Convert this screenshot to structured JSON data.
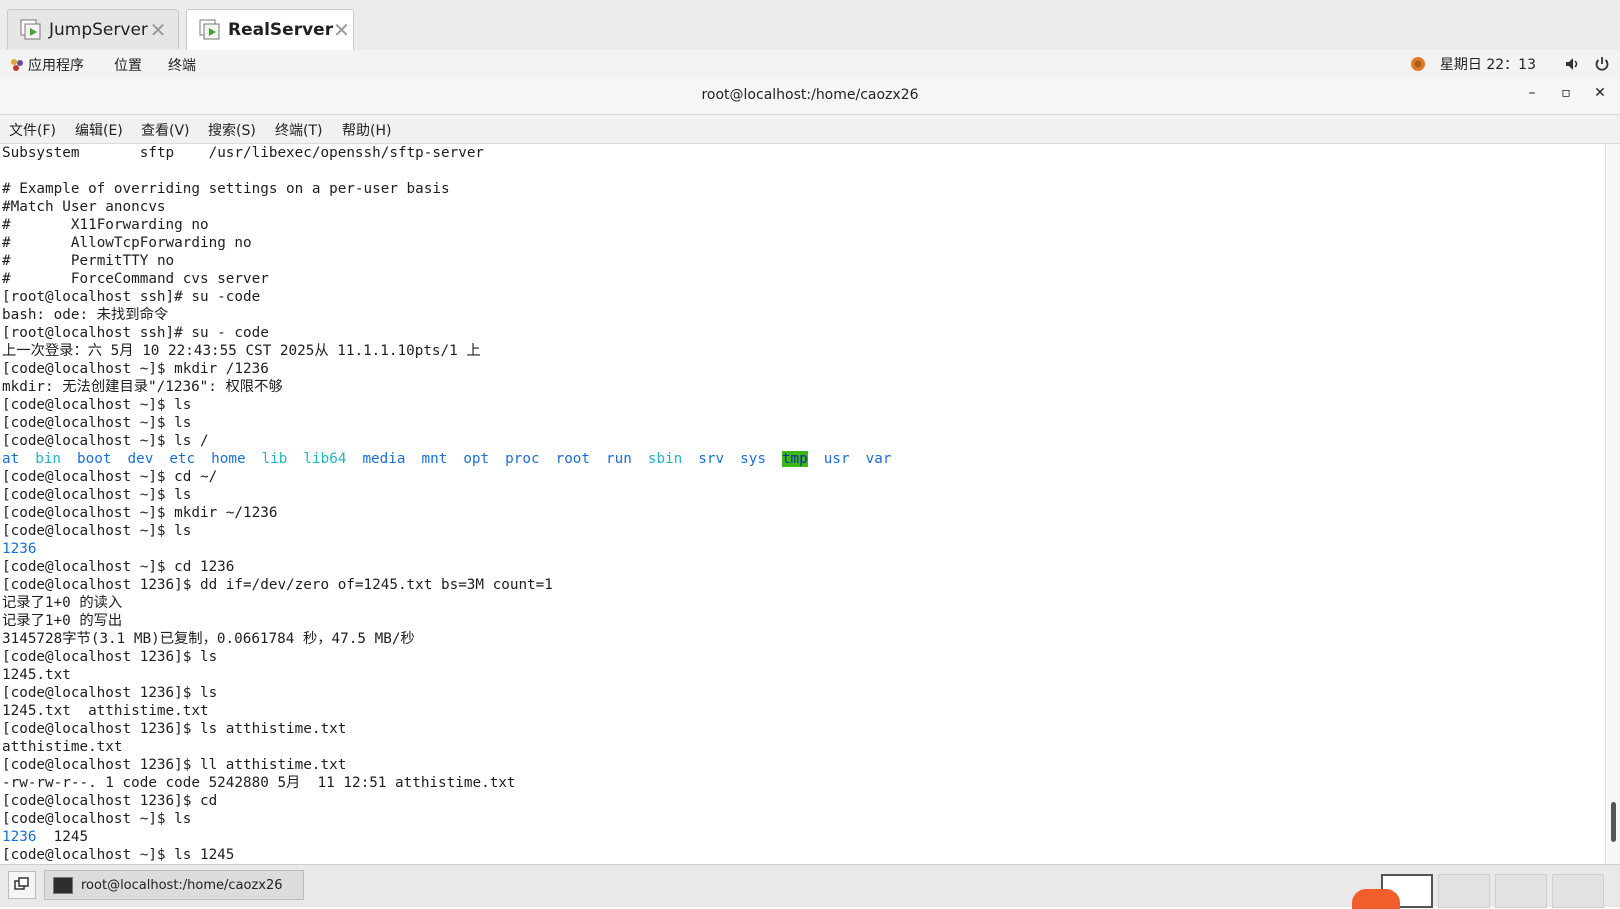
{
  "tabs": [
    {
      "label": "JumpServer",
      "active": false
    },
    {
      "label": "RealServer",
      "active": true
    }
  ],
  "topbar": {
    "menus": [
      "应用程序",
      "位置",
      "终端"
    ],
    "clock": "星期日 22：13"
  },
  "window": {
    "title": "root@localhost:/home/caozx26",
    "minimize": "–",
    "maximize": "▫",
    "close": "✕"
  },
  "menubar": [
    "文件(F)",
    "编辑(E)",
    "查看(V)",
    "搜索(S)",
    "终端(T)",
    "帮助(H)"
  ],
  "terminal": {
    "lines": [
      "Subsystem\tsftp\t/usr/libexec/openssh/sftp-server",
      "",
      "# Example of overriding settings on a per-user basis",
      "#Match User anoncvs",
      "#\tX11Forwarding no",
      "#\tAllowTcpForwarding no",
      "#\tPermitTTY no",
      "#\tForceCommand cvs server",
      "[root@localhost ssh]# su -code",
      "bash: ode: 未找到命令",
      "[root@localhost ssh]# su - code",
      "上一次登录：六 5月 10 22:43:55 CST 2025从 11.1.1.10pts/1 上",
      "[code@localhost ~]$ mkdir /1236",
      "mkdir: 无法创建目录\"/1236\": 权限不够",
      "[code@localhost ~]$ ls",
      "[code@localhost ~]$ ls",
      "[code@localhost ~]$ ls /"
    ],
    "dir_listing": [
      {
        "name": "at",
        "color": "blue"
      },
      {
        "name": "bin",
        "color": "cyan"
      },
      {
        "name": "boot",
        "color": "blue"
      },
      {
        "name": "dev",
        "color": "blue"
      },
      {
        "name": "etc",
        "color": "blue"
      },
      {
        "name": "home",
        "color": "blue"
      },
      {
        "name": "lib",
        "color": "cyan"
      },
      {
        "name": "lib64",
        "color": "cyan"
      },
      {
        "name": "media",
        "color": "blue"
      },
      {
        "name": "mnt",
        "color": "blue"
      },
      {
        "name": "opt",
        "color": "blue"
      },
      {
        "name": "proc",
        "color": "blue"
      },
      {
        "name": "root",
        "color": "blue"
      },
      {
        "name": "run",
        "color": "blue"
      },
      {
        "name": "sbin",
        "color": "cyan"
      },
      {
        "name": "srv",
        "color": "blue"
      },
      {
        "name": "sys",
        "color": "blue"
      },
      {
        "name": "tmp",
        "color": "tmp"
      },
      {
        "name": "usr",
        "color": "blue"
      },
      {
        "name": "var",
        "color": "blue"
      }
    ],
    "lines2": [
      "[code@localhost ~]$ cd ~/",
      "[code@localhost ~]$ ls",
      "[code@localhost ~]$ mkdir ~/1236",
      "[code@localhost ~]$ ls"
    ],
    "ls_result_1": "1236",
    "lines3": [
      "[code@localhost ~]$ cd 1236",
      "[code@localhost 1236]$ dd if=/dev/zero of=1245.txt bs=3M count=1",
      "记录了1+0 的读入",
      "记录了1+0 的写出",
      "3145728字节(3.1 MB)已复制，0.0661784 秒，47.5 MB/秒",
      "[code@localhost 1236]$ ls",
      "1245.txt",
      "[code@localhost 1236]$ ls",
      "1245.txt  atthistime.txt",
      "[code@localhost 1236]$ ls atthistime.txt",
      "atthistime.txt",
      "[code@localhost 1236]$ ll atthistime.txt",
      "-rw-rw-r--. 1 code code 5242880 5月  11 12:51 atthistime.txt",
      "[code@localhost 1236]$ cd",
      "[code@localhost ~]$ ls"
    ],
    "ls_result_2_dir": "1236",
    "ls_result_2_file": "  1245",
    "last_line": "[code@localhost ~]$ ls 1245"
  },
  "taskbar": {
    "task_label": "root@localhost:/home/caozx26"
  }
}
